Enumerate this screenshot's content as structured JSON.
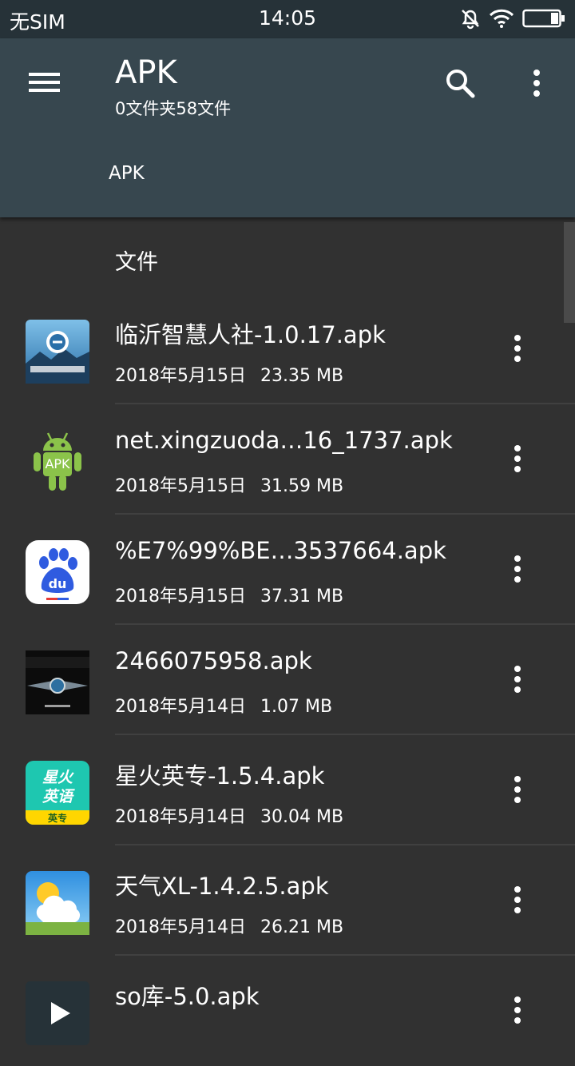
{
  "status_bar": {
    "carrier": "无SIM",
    "time": "14:05",
    "icons": [
      "bell-muted-icon",
      "wifi-icon",
      "battery-icon"
    ]
  },
  "app_bar": {
    "title": "APK",
    "subtitle": "0文件夹58文件",
    "breadcrumb": "APK",
    "icons": [
      "menu-icon",
      "search-icon",
      "more-vert-icon"
    ]
  },
  "list": {
    "section_header": "文件",
    "files": [
      {
        "name": "临沂智慧人社-1.0.17.apk",
        "date": "2018年5月15日",
        "size": "23.35 MB",
        "icon": "linyi-app-icon"
      },
      {
        "name": "net.xingzuoda…16_1737.apk",
        "date": "2018年5月15日",
        "size": "31.59 MB",
        "icon": "android-apk-icon"
      },
      {
        "name": "%E7%99%BE…3537664.apk",
        "date": "2018年5月15日",
        "size": "37.31 MB",
        "icon": "baidu-icon"
      },
      {
        "name": "2466075958.apk",
        "date": "2018年5月14日",
        "size": "1.07 MB",
        "icon": "game-app-icon"
      },
      {
        "name": "星火英专-1.5.4.apk",
        "date": "2018年5月14日",
        "size": "30.04 MB",
        "icon": "xinghuo-icon",
        "icon_text": [
          "星火",
          "英语",
          "英专"
        ]
      },
      {
        "name": "天气XL-1.4.2.5.apk",
        "date": "2018年5月14日",
        "size": "26.21 MB",
        "icon": "weather-icon"
      },
      {
        "name": "so库-5.0.apk",
        "date": "",
        "size": "",
        "icon": "play-icon"
      }
    ]
  },
  "colors": {
    "status_bar": "#263238",
    "app_bar": "#37474F",
    "background": "#313131",
    "divider": "#404040",
    "text": "#FFFFFF"
  }
}
